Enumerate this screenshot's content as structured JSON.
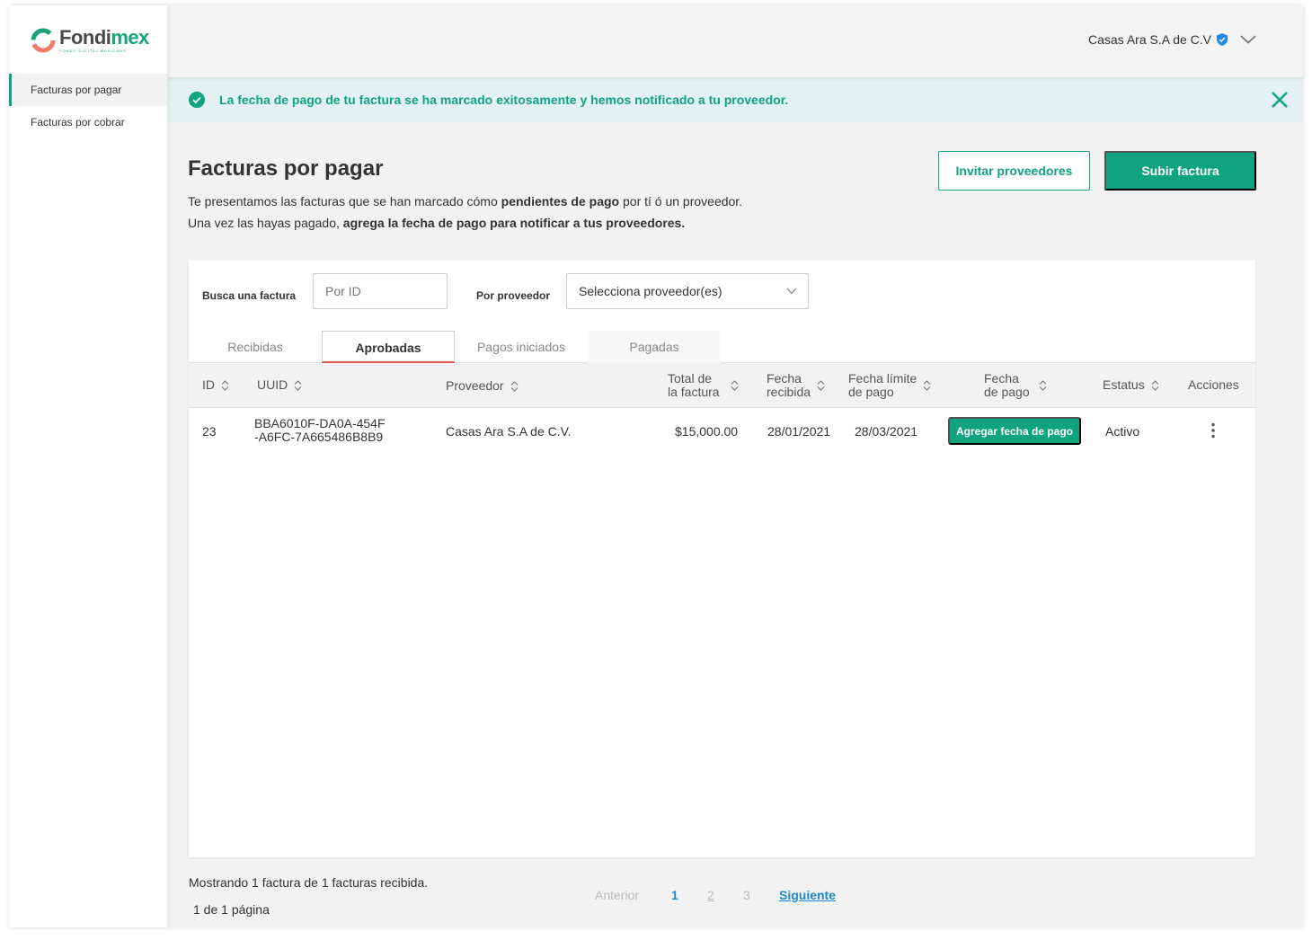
{
  "brand": {
    "name_part1": "Fondi",
    "name_part2": "mex",
    "tagline": "FONDO DIGITAL MEXICANO",
    "primary_color": "#10a37f"
  },
  "sidebar": {
    "items": [
      {
        "label": "Facturas por pagar",
        "active": true
      },
      {
        "label": "Facturas por cobrar",
        "active": false
      }
    ]
  },
  "header": {
    "account_name": "Casas Ara S.A de C.V",
    "verified_icon": "shield-check-icon",
    "menu_icon": "chevron-down-icon"
  },
  "alert": {
    "text": "La fecha de pago de tu factura se ha marcado exitosamente y hemos notificado a tu proveedor.",
    "icon": "check-circle-icon",
    "close_icon": "close-icon"
  },
  "page": {
    "title_regular": "Facturas",
    "title_bold": "por pagar",
    "desc_line1_a": "Te presentamos las facturas que se han marcado cómo",
    "desc_line1_b": "pendientes de pago",
    "desc_line1_c": "por tí ó un proveedor.",
    "desc_line2_a": "Una vez las hayas pagado,",
    "desc_line2_b": "agrega la fecha de pago para notificar a tus proveedores."
  },
  "actions": {
    "invite_label": "Invitar proveedores",
    "upload_label": "Subir factura"
  },
  "filters": {
    "search_label": "Busca una factura",
    "search_placeholder": "Por ID",
    "provider_label": "Por proveedor",
    "provider_placeholder": "Selecciona proveedor(es)"
  },
  "tabs": [
    {
      "label": "Recibidas",
      "active": false
    },
    {
      "label": "Aprobadas",
      "active": true
    },
    {
      "label": "Pagos iniciados",
      "active": false
    },
    {
      "label": "Pagadas",
      "active": false
    }
  ],
  "table": {
    "headers": {
      "id": "ID",
      "uuid": "UUID",
      "proveedor": "Proveedor",
      "total_1": "Total de",
      "total_2": "la factura",
      "recibida_1": "Fecha",
      "recibida_2": "recibida",
      "limite_1": "Fecha límite",
      "limite_2": "de pago",
      "pago_1": "Fecha",
      "pago_2": "de pago",
      "estatus": "Estatus",
      "acciones": "Acciones"
    },
    "rows": [
      {
        "id": "23",
        "uuid_1": "BBA6010F-DA0A-454F",
        "uuid_2": "-A6FC-7A665486B8B9",
        "proveedor": "Casas Ara S.A de C.V.",
        "total": "$15,000.00",
        "fecha_recibida": "28/01/2021",
        "fecha_limite": "28/03/2021",
        "action_label": "Agregar fecha de pago",
        "estatus": "Activo"
      }
    ]
  },
  "footer": {
    "showing": "Mostrando 1 factura de 1 facturas recibida.",
    "page_info": "1 de 1 página",
    "prev": "Anterior",
    "pages": [
      "1",
      "2",
      "3"
    ],
    "next": "Siguiente"
  }
}
